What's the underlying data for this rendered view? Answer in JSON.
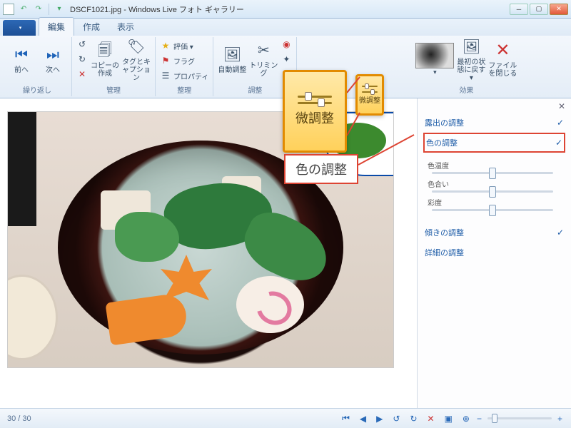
{
  "title": {
    "filename": "DSCF1021.jpg",
    "app": "Windows Live フォト ギャラリー"
  },
  "tabs": {
    "edit": "編集",
    "create": "作成",
    "view": "表示"
  },
  "ribbon": {
    "nav": {
      "prev": "前へ",
      "next": "次へ",
      "group": "繰り返し"
    },
    "manage": {
      "copy": "コピーの作成",
      "tag": "タグとキャプション",
      "delete_icon": "×",
      "group": "管理"
    },
    "organize": {
      "rating": "評価 ▾",
      "flag": "フラグ",
      "properties": "プロパティ",
      "group": "整理"
    },
    "adjust": {
      "auto": "自動調整",
      "crop": "トリミング",
      "group": "調整"
    },
    "fine_tune": "微調整",
    "effects": {
      "revert": "最初の状態に戻す ▾",
      "close": "ファイルを閉じる",
      "group": "効果"
    }
  },
  "callouts": {
    "fine_tune_label": "微調整",
    "color_adjust_label": "色の調整"
  },
  "panel": {
    "exposure": "露出の調整",
    "color": "色の調整",
    "sliders": {
      "temperature": "色温度",
      "tint": "色合い",
      "saturation": "彩度"
    },
    "straighten": "傾きの調整",
    "detail": "詳細の調整"
  },
  "status": {
    "counter": "30 / 30"
  }
}
